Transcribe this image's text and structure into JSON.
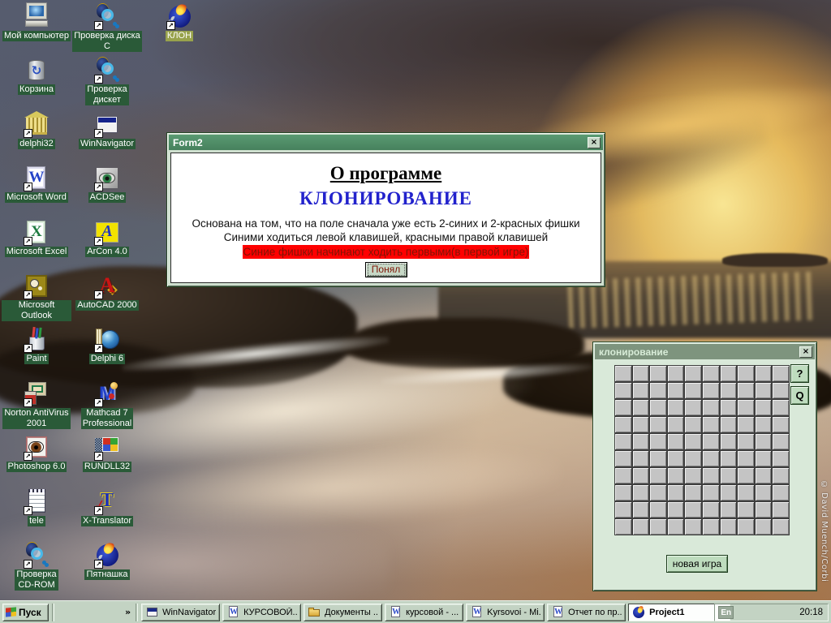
{
  "colors": {
    "active_title": "#4f8c64",
    "inactive_title": "#7e947e",
    "ui_face": "#c3d3c3",
    "icon_label_bg": "#2a5a38",
    "selected_icon_label_bg": "#98a24c",
    "heading_blue": "#2222cc",
    "alert_red": "#ff0000"
  },
  "ui": {
    "close_glyph": "×"
  },
  "desktop": {
    "credit": "© David Muench/Corbi",
    "columns": [
      [
        {
          "name": "icon-my-computer",
          "label": "Мой компьютер",
          "icon": "computer",
          "shortcut": false
        },
        {
          "name": "icon-recycle-bin",
          "label": "Корзина",
          "icon": "recycle",
          "shortcut": false
        },
        {
          "name": "icon-delphi32",
          "label": "delphi32",
          "icon": "bank",
          "shortcut": true
        },
        {
          "name": "icon-microsoft-word",
          "label": "Microsoft Word",
          "icon": "word",
          "shortcut": true
        },
        {
          "name": "icon-microsoft-excel",
          "label": "Microsoft Excel",
          "icon": "excel",
          "shortcut": true
        },
        {
          "name": "icon-microsoft-outlook",
          "label": "Microsoft Outlook",
          "icon": "outlook",
          "shortcut": true
        },
        {
          "name": "icon-paint",
          "label": "Paint",
          "icon": "paint",
          "shortcut": true
        },
        {
          "name": "icon-norton-antivirus",
          "label": "Norton AntiVirus\n2001",
          "icon": "norton",
          "shortcut": true
        },
        {
          "name": "icon-photoshop",
          "label": "Photoshop 6.0",
          "icon": "photoshop",
          "shortcut": true
        },
        {
          "name": "icon-tele",
          "label": "tele",
          "icon": "notepad",
          "shortcut": true
        },
        {
          "name": "icon-check-cdrom",
          "label": "Проверка\nCD-ROM",
          "icon": "scanbug",
          "shortcut": true
        }
      ],
      [
        {
          "name": "icon-check-disk-c",
          "label": "Проверка диска\nС",
          "icon": "scanbug",
          "shortcut": true
        },
        {
          "name": "icon-check-floppy",
          "label": "Проверка\nдискет",
          "icon": "scanbug",
          "shortcut": true
        },
        {
          "name": "icon-winnavigator",
          "label": "WinNavigator",
          "icon": "winnav",
          "shortcut": true
        },
        {
          "name": "icon-acdsee",
          "label": "ACDSee",
          "icon": "acdsee",
          "shortcut": true
        },
        {
          "name": "icon-arcon",
          "label": "ArCon 4.0",
          "icon": "arcon",
          "shortcut": true
        },
        {
          "name": "icon-autocad",
          "label": "AutoCAD 2000",
          "icon": "autocad",
          "shortcut": true
        },
        {
          "name": "icon-delphi6",
          "label": "Delphi 6",
          "icon": "delphi",
          "shortcut": true
        },
        {
          "name": "icon-mathcad",
          "label": "Mathcad 7\nProfessional",
          "icon": "mathcad",
          "shortcut": true
        },
        {
          "name": "icon-rundll32",
          "label": "RUNDLL32",
          "icon": "rundll",
          "shortcut": true
        },
        {
          "name": "icon-x-translator",
          "label": "X-Translator",
          "icon": "xtranslator",
          "shortcut": true
        },
        {
          "name": "icon-pyatnashka",
          "label": "Пятнашка",
          "icon": "torch",
          "shortcut": true
        }
      ],
      [
        {
          "name": "icon-klon",
          "label": "КЛОН",
          "icon": "torch",
          "shortcut": true,
          "selected": true
        }
      ]
    ]
  },
  "about_dialog": {
    "title": "Form2",
    "heading": "О программе",
    "subheading": "КЛОНИРОВАНИЕ",
    "line1": "Основана на том, что на поле сначала уже есть 2-синих и 2-красных фишки",
    "line2": "Синими ходиться левой клавишей, красными правой клавишей",
    "highlight": "Синие фишки начинают ходить первыми(в первой игре)",
    "ok_button": "Понял"
  },
  "game_window": {
    "title": "клонирование",
    "help_button": "?",
    "quit_button": "Q",
    "new_game_button": "новая игра",
    "grid": {
      "rows": 10,
      "cols": 10
    }
  },
  "taskbar": {
    "start_label": "Пуск",
    "overflow_chevron": "»",
    "quick_launch": [
      {
        "name": "quick-launch-monitor-icon",
        "icon": "qmonitor"
      },
      {
        "name": "show-desktop-icon",
        "icon": "qdesktop"
      },
      {
        "name": "outlook-express-icon",
        "icon": "qmail"
      },
      {
        "name": "media-player-icon",
        "icon": "qplayer"
      }
    ],
    "tasks": [
      {
        "label": "WinNavigator",
        "icon": "winnav"
      },
      {
        "label": "КУРСОВОЙ...",
        "icon": "word"
      },
      {
        "label": "Документы ...",
        "icon": "folder"
      },
      {
        "label": "курсовой - ...",
        "icon": "word"
      },
      {
        "label": "Kyrsovoi - Mi...",
        "icon": "word"
      },
      {
        "label": "Отчет по пр...",
        "icon": "word"
      },
      {
        "label": "Project1",
        "icon": "torch",
        "active": true
      }
    ],
    "tray": {
      "language": "En",
      "icons": [
        {
          "name": "speaker-icon",
          "icon": "speaker"
        },
        {
          "name": "display-settings-icon",
          "icon": "display"
        },
        {
          "name": "power-icon",
          "icon": "lightning"
        },
        {
          "name": "cd-icon",
          "icon": "cd"
        }
      ],
      "clock": "20:18"
    }
  }
}
